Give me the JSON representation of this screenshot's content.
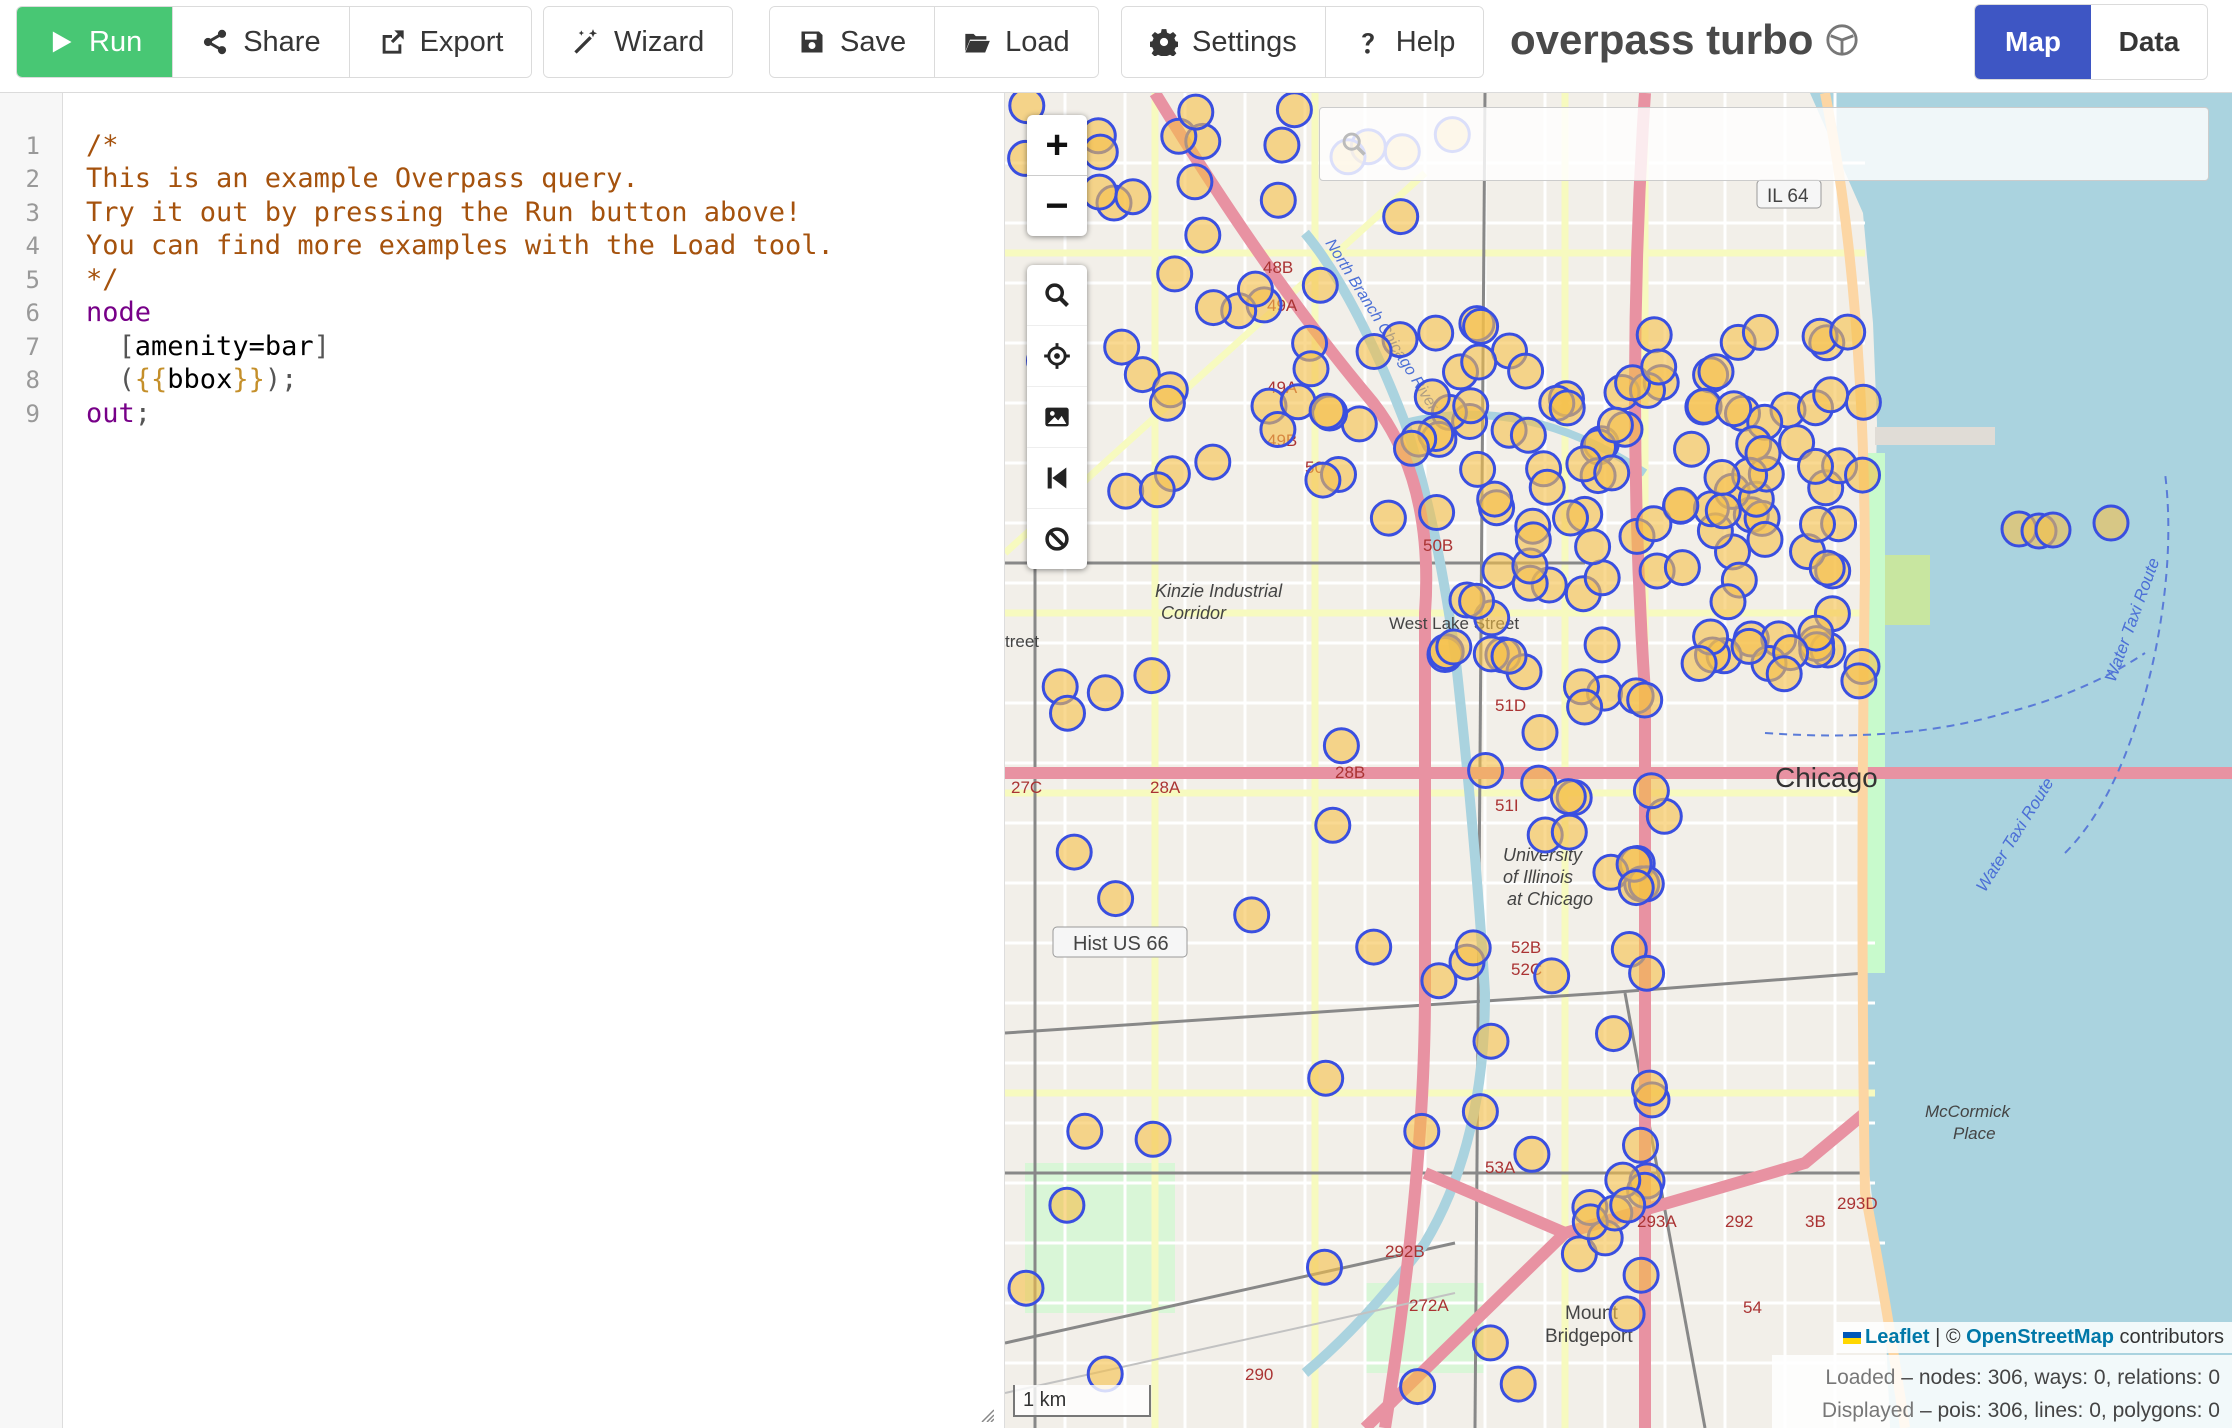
{
  "toolbar": {
    "run_label": "Run",
    "share_label": "Share",
    "export_label": "Export",
    "wizard_label": "Wizard",
    "save_label": "Save",
    "load_label": "Load",
    "settings_label": "Settings",
    "help_label": "Help",
    "app_title": "overpass turbo",
    "view_map_label": "Map",
    "view_data_label": "Data",
    "active_view": "Map",
    "run_color": "#48c774",
    "map_active_color": "#3e56c4"
  },
  "editor": {
    "line_numbers": [
      "1",
      "2",
      "3",
      "4",
      "5",
      "6",
      "7",
      "8",
      "9"
    ],
    "lines": {
      "l1": "/*",
      "l2": "This is an example Overpass query.",
      "l3": "Try it out by pressing the Run button above!",
      "l4": "You can find more examples with the Load tool.",
      "l5": "*/",
      "l6": "node",
      "l7_open": "[",
      "l7_text": "amenity=bar",
      "l7_close": "]",
      "l8_open": "(",
      "l8_tpl_open": "{{",
      "l8_text": "bbox",
      "l8_tpl_close": "}}",
      "l8_close": ");",
      "l9_kw": "out",
      "l9_end": ";"
    }
  },
  "map": {
    "zoom_in": "+",
    "zoom_out": "−",
    "search_placeholder": "",
    "labels": {
      "il64": "IL 64",
      "chicago": "Chicago",
      "hist_us66": "Hist US 66",
      "uic": "University of Illinois at Chicago",
      "uic_1": "University",
      "uic_2": "of Illinois",
      "uic_3": "at Chicago",
      "west_lake": "West Lake Street",
      "kinzie_1": "Kinzie Industrial",
      "kinzie_2": "Corridor",
      "mccormick_1": "McCormick",
      "mccormick_2": "Place",
      "mount_1": "Mount",
      "mount_2": "Bridgeport",
      "water_taxi": "Water Taxi Route",
      "north_branch": "North Branch Chicago River",
      "street": "treet",
      "exits": [
        "48B",
        "49A",
        "49A",
        "49B",
        "50",
        "50B",
        "51D",
        "51I",
        "52B",
        "52C",
        "53A",
        "27C",
        "28A",
        "28B",
        "290",
        "292B",
        "293A",
        "292",
        "3B",
        "293D",
        "54",
        "272A"
      ]
    },
    "attribution": {
      "leaflet": "Leaflet",
      "sep": " | © ",
      "osm": "OpenStreetMap",
      "contributors": " contributors"
    },
    "stats": {
      "loaded_label": "Loaded",
      "loaded_value": " – nodes: 306, ways: 0, relations: 0",
      "displayed_label": "Displayed",
      "displayed_value": " – pois: 306, lines: 0, polygons: 0"
    },
    "scale_label": "1 km",
    "poi_color": "#3a4fe0",
    "poi_fill": "#f5c04a"
  }
}
